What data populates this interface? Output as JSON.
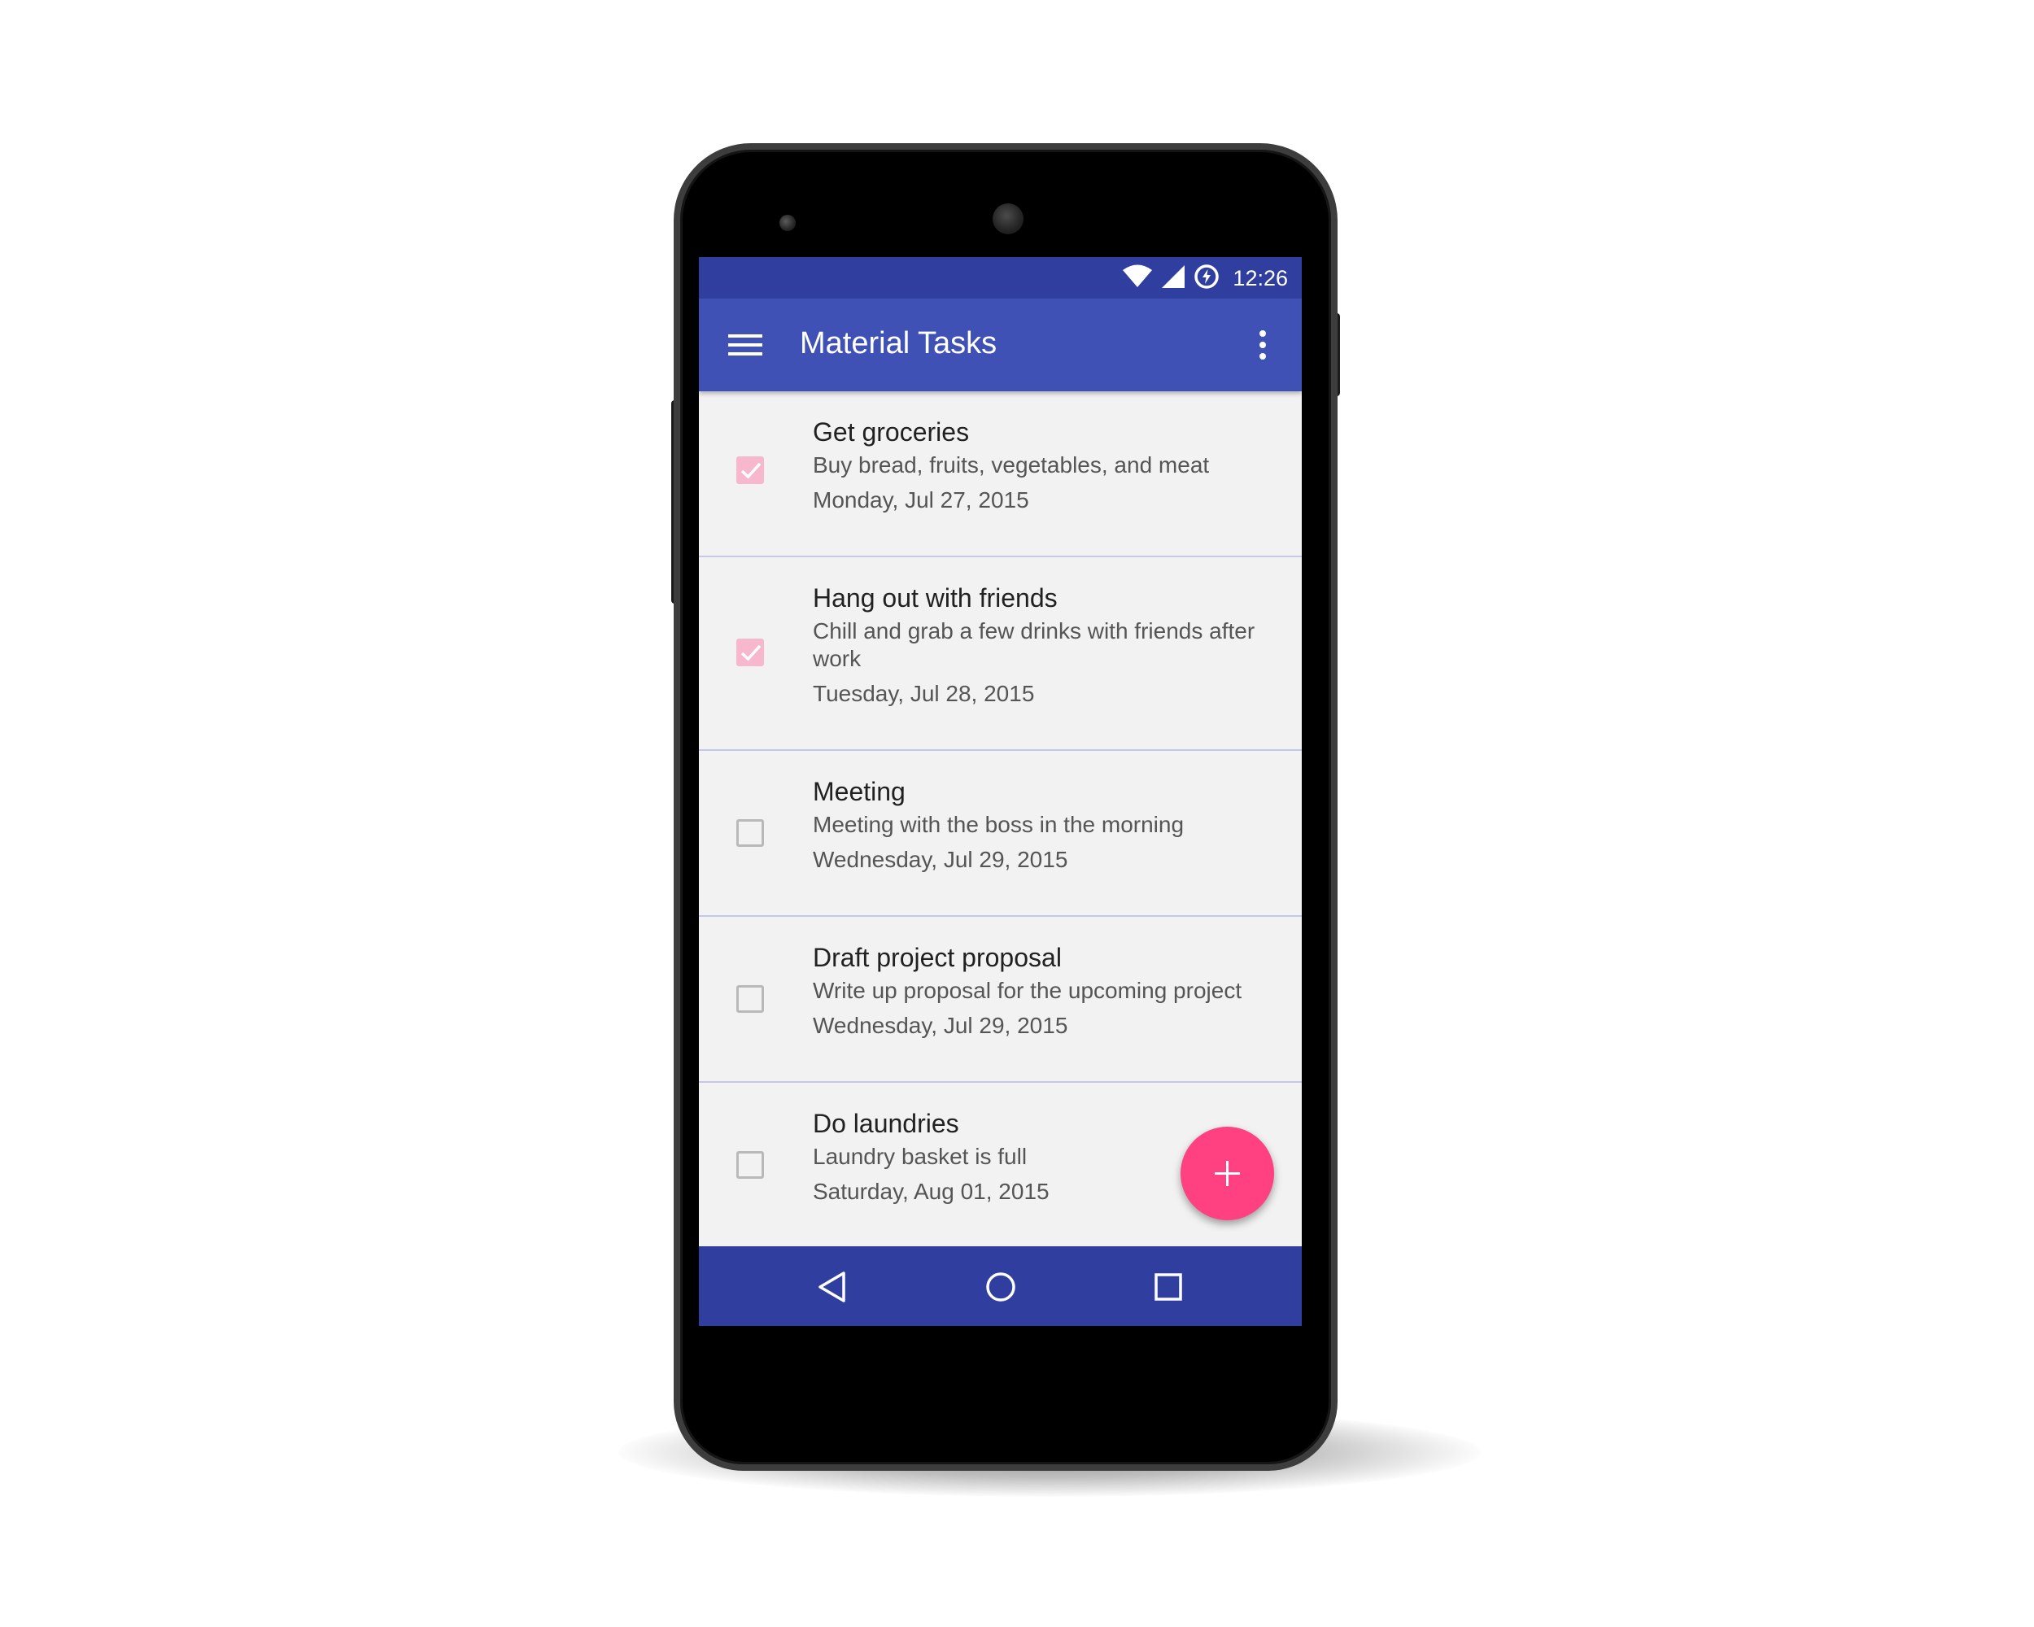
{
  "status_bar": {
    "time": "12:26",
    "icons": [
      "wifi-icon",
      "cell-signal-icon",
      "data-saver-icon"
    ]
  },
  "app_bar": {
    "title": "Material Tasks",
    "nav_icon": "menu-icon",
    "action_icon": "more-vert-icon"
  },
  "tasks": [
    {
      "title": "Get groceries",
      "description": "Buy bread, fruits, vegetables, and meat",
      "date": "Monday, Jul 27, 2015",
      "checked": true
    },
    {
      "title": "Hang out with friends",
      "description": "Chill and grab a few drinks with friends after work",
      "date": "Tuesday, Jul 28, 2015",
      "checked": true
    },
    {
      "title": "Meeting",
      "description": "Meeting with the boss in the morning",
      "date": "Wednesday, Jul 29, 2015",
      "checked": false
    },
    {
      "title": "Draft project proposal",
      "description": "Write up proposal for the upcoming project",
      "date": "Wednesday, Jul 29, 2015",
      "checked": false
    },
    {
      "title": "Do laundries",
      "description": "Laundry basket is full",
      "date": "Saturday, Aug 01, 2015",
      "checked": false
    }
  ],
  "fab": {
    "icon": "add-icon"
  },
  "nav_bar": {
    "icons": [
      "back-icon",
      "home-icon",
      "recents-icon"
    ]
  },
  "colors": {
    "primary": "#3f51b5",
    "primary_dark": "#303f9f",
    "accent": "#ff4081",
    "checked_box": "#f7b8cd",
    "divider": "#c5c8e8",
    "list_background": "#f2f2f2"
  }
}
